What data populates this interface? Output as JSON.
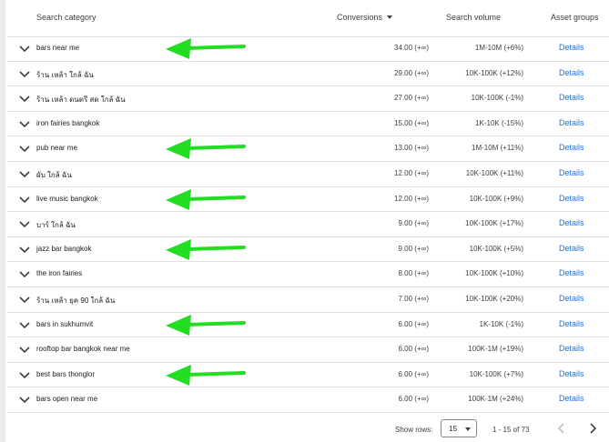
{
  "header": {
    "search_category": "Search category",
    "conversions": "Conversions",
    "search_volume": "Search volume",
    "asset_groups": "Asset groups"
  },
  "rows": [
    {
      "category": "bars near me",
      "conversions": "34.00 (+∞)",
      "volume": "1M-10M (+6%)",
      "details": "Details",
      "arrow": true
    },
    {
      "category": "ร้าน เหล้า ใกล้ ฉัน",
      "conversions": "29.00 (+∞)",
      "volume": "10K-100K (+12%)",
      "details": "Details",
      "arrow": false
    },
    {
      "category": "ร้าน เหล้า ดนตรี สด ใกล้ ฉัน",
      "conversions": "27.00 (+∞)",
      "volume": "10K-100K (-1%)",
      "details": "Details",
      "arrow": false
    },
    {
      "category": "iron fairies bangkok",
      "conversions": "15.00 (+∞)",
      "volume": "1K-10K (-15%)",
      "details": "Details",
      "arrow": false
    },
    {
      "category": "pub near me",
      "conversions": "13.00 (+∞)",
      "volume": "1M-10M (+11%)",
      "details": "Details",
      "arrow": true
    },
    {
      "category": "ผับ ใกล้ ฉัน",
      "conversions": "12.00 (+∞)",
      "volume": "10K-100K (+11%)",
      "details": "Details",
      "arrow": false
    },
    {
      "category": "live music bangkok",
      "conversions": "12.00 (+∞)",
      "volume": "10K-100K (+9%)",
      "details": "Details",
      "arrow": true
    },
    {
      "category": "บาร์ ใกล้ ฉัน",
      "conversions": "9.00 (+∞)",
      "volume": "10K-100K (+17%)",
      "details": "Details",
      "arrow": false
    },
    {
      "category": "jazz bar bangkok",
      "conversions": "9.00 (+∞)",
      "volume": "10K-100K (+5%)",
      "details": "Details",
      "arrow": true
    },
    {
      "category": "the iron fairies",
      "conversions": "8.00 (+∞)",
      "volume": "10K-100K (+10%)",
      "details": "Details",
      "arrow": false
    },
    {
      "category": "ร้าน เหล้า ยุค 90 ใกล้ ฉัน",
      "conversions": "7.00 (+∞)",
      "volume": "10K-100K (+20%)",
      "details": "Details",
      "arrow": false
    },
    {
      "category": "bars in sukhumvit",
      "conversions": "6.00 (+∞)",
      "volume": "1K-10K (-1%)",
      "details": "Details",
      "arrow": true
    },
    {
      "category": "rooftop bar bangkok near me",
      "conversions": "6.00 (+∞)",
      "volume": "100K-1M (+19%)",
      "details": "Details",
      "arrow": false
    },
    {
      "category": "best bars thonglor",
      "conversions": "6.00 (+∞)",
      "volume": "10K-100K (+7%)",
      "details": "Details",
      "arrow": true
    },
    {
      "category": "bars open near me",
      "conversions": "6.00 (+∞)",
      "volume": "100K-1M (+24%)",
      "details": "Details",
      "arrow": false
    }
  ],
  "footer": {
    "show_rows_label": "Show rows:",
    "rows_per_page": "15",
    "range": "1 - 15 of 73"
  },
  "colors": {
    "link": "#1a73e8",
    "arrow": "#22dd22"
  },
  "icons": {
    "expand": "chevron-down-icon",
    "sort": "sort-descending-icon",
    "prev": "chevron-left-icon",
    "next": "chevron-right-icon",
    "annotation": "arrow-left-annotation"
  }
}
